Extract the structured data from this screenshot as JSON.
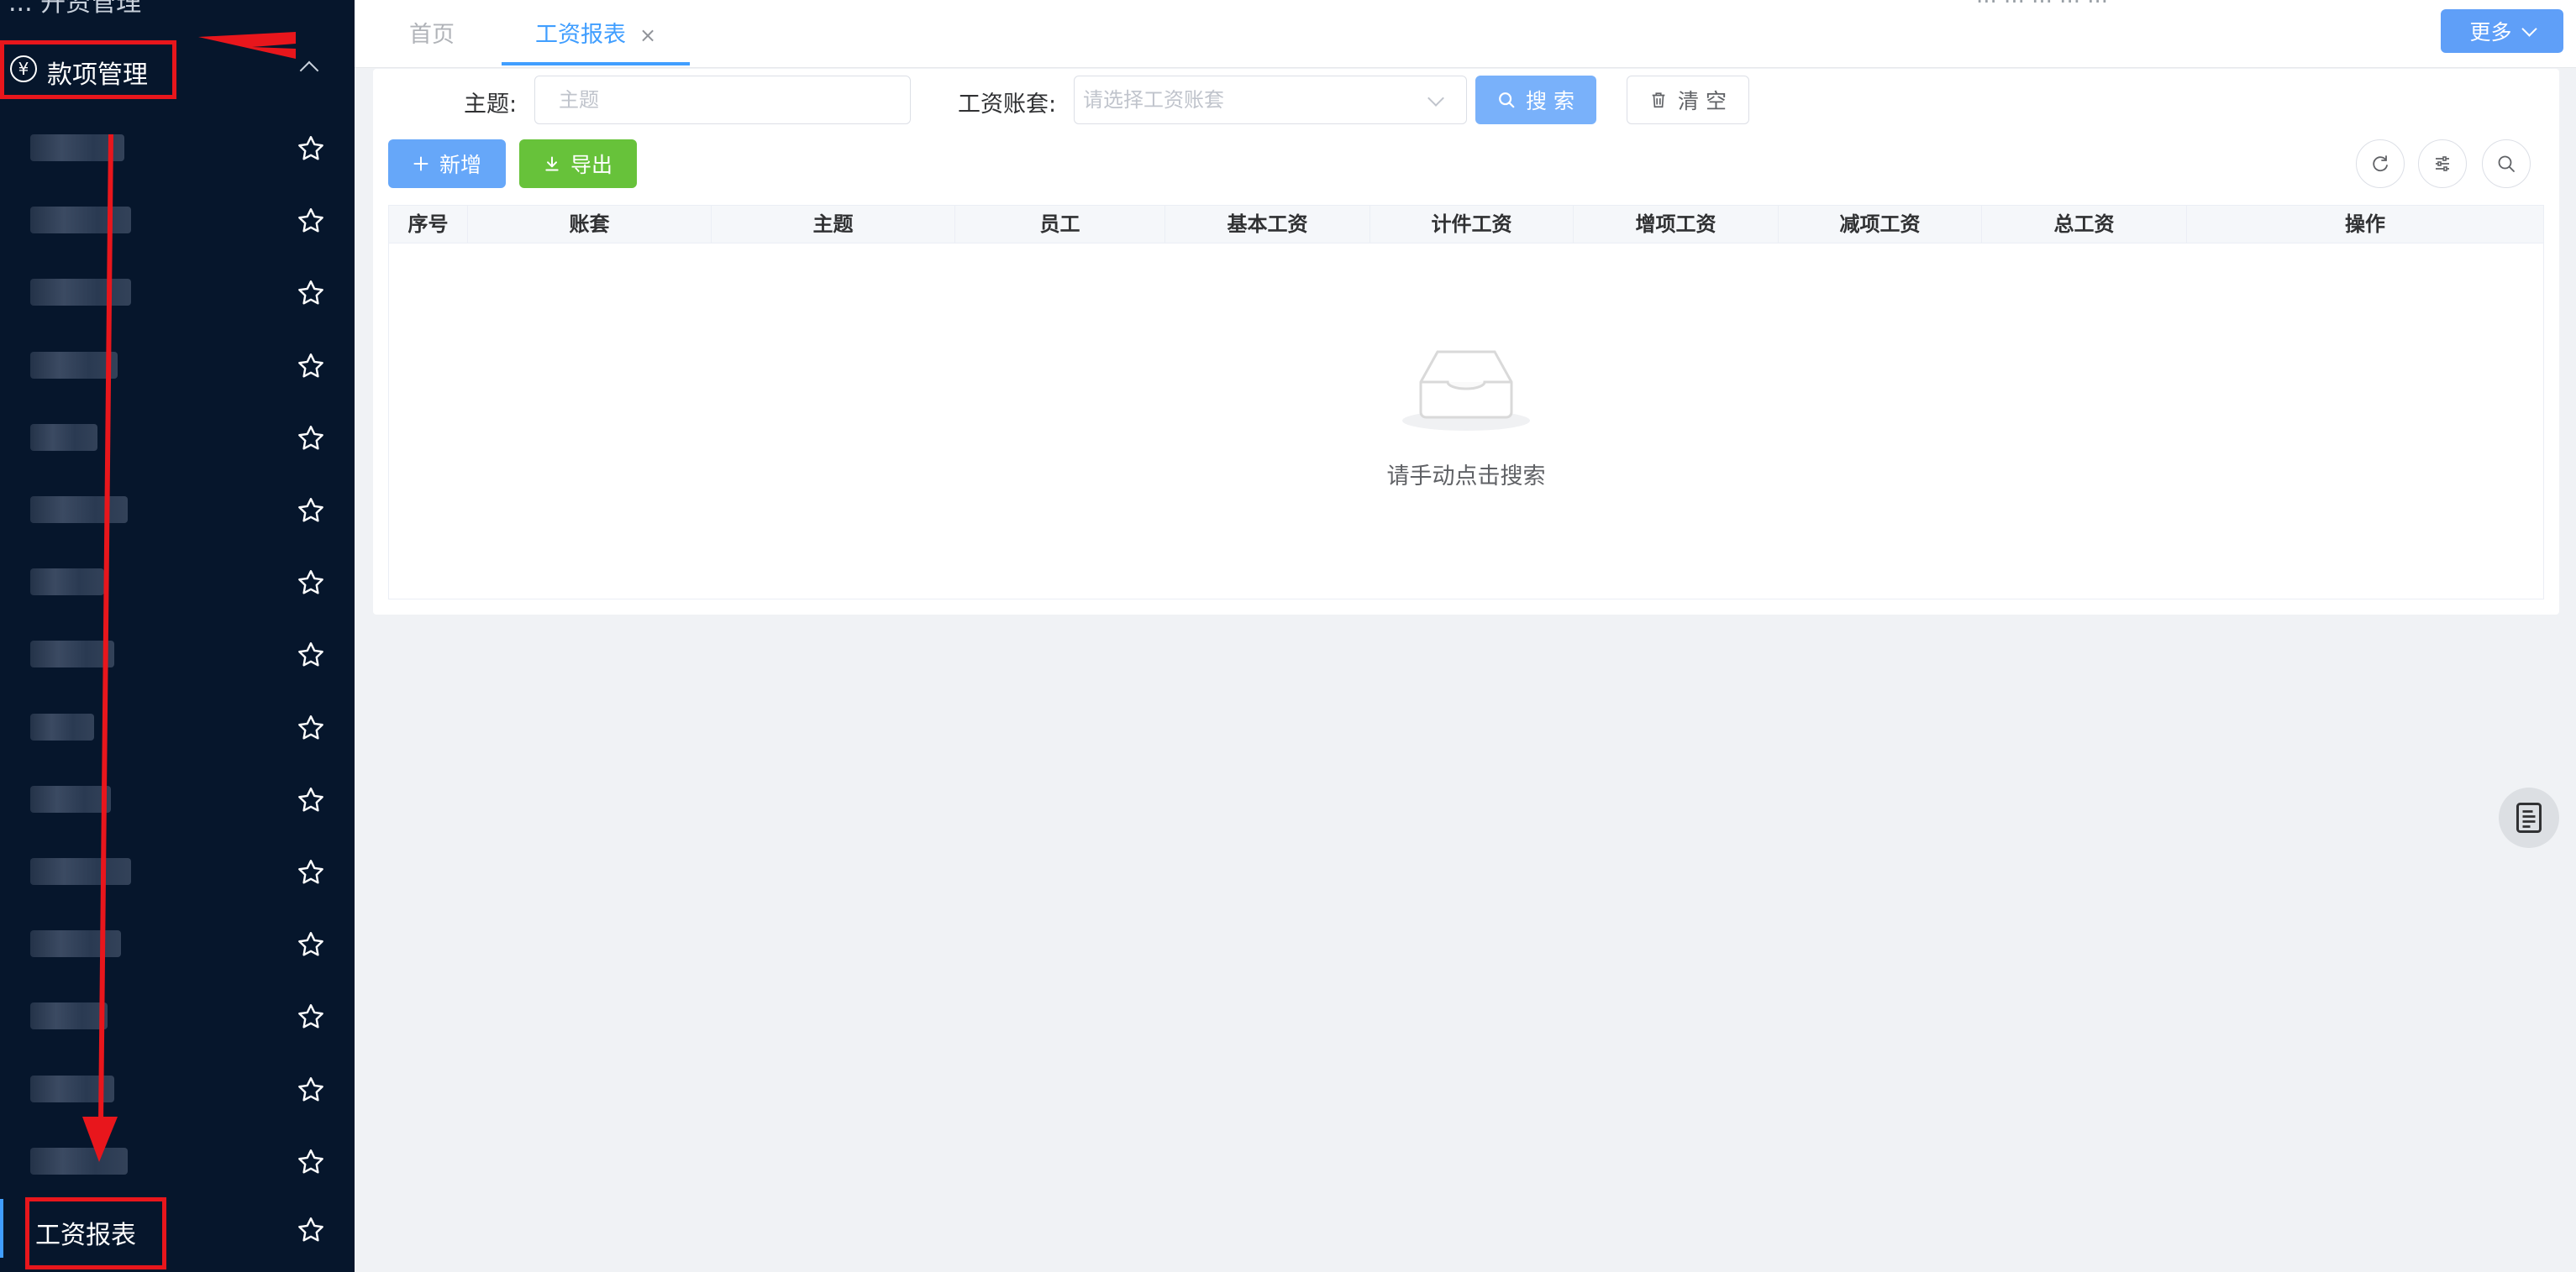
{
  "sidebar": {
    "clipped_top_label": "... 开资管理",
    "group": {
      "label": "款项管理",
      "icon": "yen-circle-icon"
    },
    "items_count_hidden": 15,
    "active_item": {
      "label": "工资报表"
    }
  },
  "tabs": [
    {
      "label": "首页",
      "active": false
    },
    {
      "label": "工资报表",
      "active": true,
      "closable": true,
      "close_glyph": "×"
    }
  ],
  "top_clipped_text": "... ... ... ... ...",
  "more_button": {
    "label": "更多"
  },
  "filters": {
    "subject_label": "主题:",
    "subject_placeholder": "主题",
    "account_label": "工资账套:",
    "account_placeholder": "请选择工资账套",
    "search_label": "搜 索",
    "clear_label": "清 空"
  },
  "toolbar": {
    "add_label": "新增",
    "export_label": "导出"
  },
  "table": {
    "columns": [
      "序号",
      "账套",
      "主题",
      "员工",
      "基本工资",
      "计件工资",
      "增项工资",
      "减项工资",
      "总工资",
      "操作"
    ],
    "rows": [],
    "empty_text": "请手动点击搜索"
  },
  "colors": {
    "primary": "#409eff",
    "success": "#67c23a",
    "sidebar_bg": "#06162c",
    "annotation_red": "#e8161c"
  }
}
